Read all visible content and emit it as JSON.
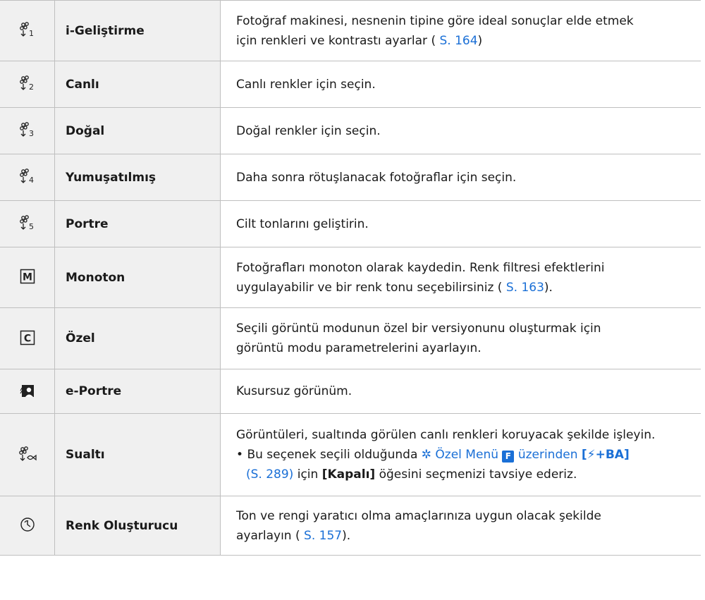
{
  "rows": [
    {
      "icon": "picture-mode-1-icon",
      "name": "i-Geliştirme",
      "desc1": "Fotoğraf makinesi, nesnenin tipine göre ideal sonuçlar elde etmek",
      "desc2_pre": "için renkleri ve kontrastı ayarlar (",
      "desc2_link": " S. 164",
      "desc2_post": ")"
    },
    {
      "icon": "picture-mode-2-icon",
      "name": "Canlı",
      "desc1": "Canlı renkler için seçin."
    },
    {
      "icon": "picture-mode-3-icon",
      "name": "Doğal",
      "desc1": "Doğal renkler için seçin."
    },
    {
      "icon": "picture-mode-4-icon",
      "name": "Yumuşatılmış",
      "desc1": "Daha sonra rötuşlanacak fotoğraflar için seçin."
    },
    {
      "icon": "picture-mode-5-icon",
      "name": "Portre",
      "desc1": "Cilt tonlarını geliştirin."
    },
    {
      "icon": "monotone-m-icon",
      "name": "Monoton",
      "desc1": "Fotoğrafları monoton olarak kaydedin. Renk filtresi efektlerini",
      "desc2_pre": "uygulayabilir ve bir renk tonu seçebilirsiniz (",
      "desc2_link": " S. 163",
      "desc2_post": ")."
    },
    {
      "icon": "custom-c-icon",
      "name": "Özel",
      "desc1": "Seçili görüntü modunun özel bir versiyonunu oluşturmak için",
      "desc2": "görüntü modu parametrelerini ayarlayın."
    },
    {
      "icon": "e-portrait-icon",
      "name": "e-Portre",
      "desc1": "Kusursuz görünüm."
    },
    {
      "icon": "underwater-icon",
      "name": "Sualtı",
      "desc1": "Görüntüleri, sualtında görülen canlı renkleri koruyacak şekilde işleyin.",
      "bullet": "•",
      "b1_pre": "Bu seçenek seçili olduğunda",
      "b1_menu": "Özel Menü",
      "b1_badge": "F",
      "b1_mid": "üzerinden",
      "b1_setting": "[",
      "b1_setting2": "+BA]",
      "b2_link": "(S. 289)",
      "b2_mid": "için",
      "b2_bold": "[Kapalı]",
      "b2_post": "öğesini seçmenizi tavsiye ederiz."
    },
    {
      "icon": "color-creator-icon",
      "name": "Renk Oluşturucu",
      "desc1": "Ton ve rengi yaratıcı olma amaçlarınıza uygun olacak şekilde",
      "desc2_pre": "ayarlayın (",
      "desc2_link": " S. 157",
      "desc2_post": ")."
    }
  ]
}
